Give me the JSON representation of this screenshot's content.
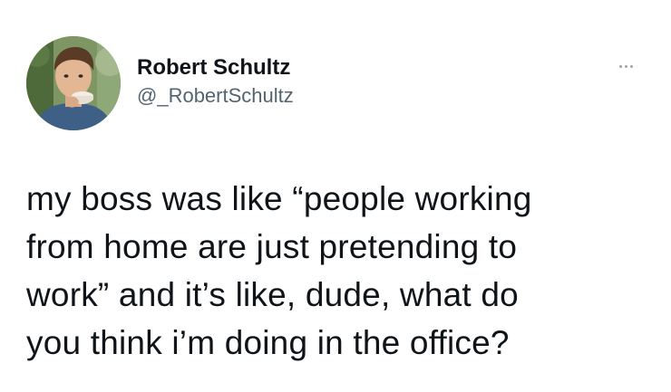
{
  "author": {
    "display_name": "Robert Schultz",
    "handle": "@_RobertSchultz"
  },
  "tweet": {
    "text": "my boss was like “people working\nfrom home are just pretending to\nwork” and it’s like, dude, what do\nyou think i’m doing in the office?"
  },
  "icons": {
    "more": "more-horizontal-icon",
    "avatar": "profile-photo"
  },
  "colors": {
    "background": "#ffffff",
    "name": "#0f1419",
    "handle": "#536471",
    "more_dots": "#9aa4ad"
  }
}
